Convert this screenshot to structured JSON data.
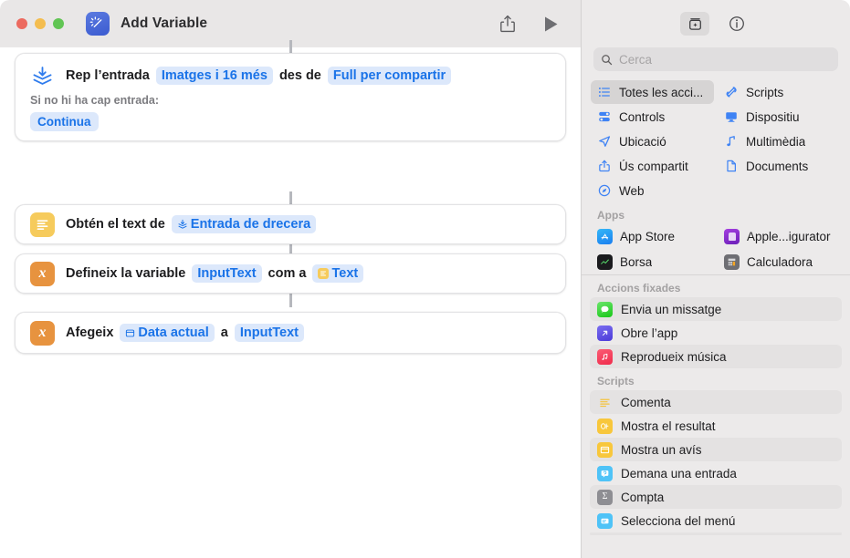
{
  "window": {
    "title": "Add Variable",
    "app_icon": "shortcuts-icon",
    "traffic_lights": [
      "close",
      "minimize",
      "zoom"
    ],
    "toolbar": {
      "share_label": "share-icon",
      "run_label": "run-icon"
    }
  },
  "colors": {
    "accent_blue": "#1a73e8",
    "token_bg": "#dce8fb",
    "titlebar_bg": "#e9e7e7",
    "sidebar_bg": "#eceaea",
    "icon_yellow": "#f6cb5c",
    "icon_orange": "#e7933f",
    "connector": "#b6b8bd"
  },
  "actions": [
    {
      "id": "receive-input",
      "icon": "receive-input-icon",
      "text_before": "Rep l’entrada",
      "token1": "Imatges i 16 més",
      "text_middle": "des de",
      "token2": "Full per compartir",
      "sub_label": "Si no hi ha cap entrada:",
      "sub_button": "Continua"
    },
    {
      "id": "get-text-from",
      "icon": "text-lines-icon",
      "text_before": "Obtén el text de",
      "token1": "Entrada de drecera",
      "token1_icon": "shortcut-input-icon"
    },
    {
      "id": "set-variable",
      "icon": "variable-x-icon",
      "text_before": "Defineix la variable",
      "token1": "InputText",
      "text_middle": "com a",
      "token2": "Text",
      "token2_icon": "text-lines-small-icon"
    },
    {
      "id": "add-to-variable",
      "icon": "variable-x-icon",
      "text_before": "Afegeix",
      "token1": "Data actual",
      "token1_icon": "date-icon",
      "text_middle": "a",
      "token2": "InputText"
    }
  ],
  "sidebar": {
    "toolbar": {
      "library_button": "action-library-icon",
      "info_button": "info-icon"
    },
    "search": {
      "placeholder": "Cerca",
      "value": ""
    },
    "categories": [
      {
        "label": "Totes les acci...",
        "icon": "list-bullet-icon",
        "selected": true
      },
      {
        "label": "Scripts",
        "icon": "scripts-icon",
        "selected": false
      },
      {
        "label": "Controls",
        "icon": "controls-icon",
        "selected": false
      },
      {
        "label": "Dispositiu",
        "icon": "device-icon",
        "selected": false
      },
      {
        "label": "Ubicació",
        "icon": "location-arrow-icon",
        "selected": false
      },
      {
        "label": "Multimèdia",
        "icon": "music-note-icon",
        "selected": false
      },
      {
        "label": "Ús compartit",
        "icon": "share-icon",
        "selected": false
      },
      {
        "label": "Documents",
        "icon": "document-icon",
        "selected": false
      },
      {
        "label": "Web",
        "icon": "safari-compass-icon",
        "selected": false
      }
    ],
    "apps_section": {
      "title": "Apps",
      "items": [
        {
          "label": "App Store",
          "icon": "app-store-icon"
        },
        {
          "label": "Apple...igurator",
          "icon": "apple-configurator-icon"
        },
        {
          "label": "Borsa",
          "icon": "stocks-icon"
        },
        {
          "label": "Calculadora",
          "icon": "calculator-icon"
        }
      ]
    },
    "pinned_section": {
      "title": "Accions fixades",
      "items": [
        {
          "label": "Envia un missatge",
          "icon": "messages-icon"
        },
        {
          "label": "Obre l’app",
          "icon": "open-app-icon"
        },
        {
          "label": "Reprodueix música",
          "icon": "music-icon"
        }
      ]
    },
    "scripts_section": {
      "title": "Scripts",
      "items": [
        {
          "label": "Comenta",
          "icon": "comment-icon"
        },
        {
          "label": "Mostra el resultat",
          "icon": "show-result-icon"
        },
        {
          "label": "Mostra un avís",
          "icon": "show-alert-icon"
        },
        {
          "label": "Demana una entrada",
          "icon": "ask-input-icon"
        },
        {
          "label": "Compta",
          "icon": "count-sigma-icon"
        },
        {
          "label": "Selecciona del menú",
          "icon": "choose-menu-icon"
        }
      ]
    }
  }
}
